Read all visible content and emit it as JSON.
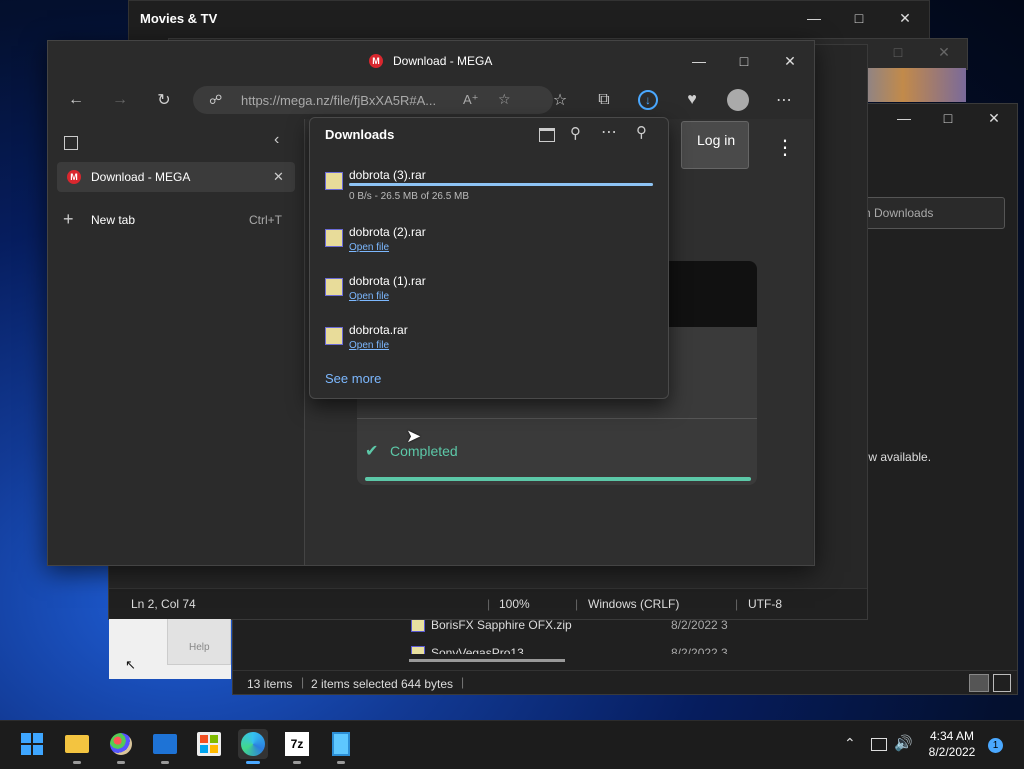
{
  "movies": {
    "title": "Movies & TV"
  },
  "explorer": {
    "search_placeholder": "ch Downloads",
    "preview_text": "iew available.",
    "files": [
      {
        "name": "BorisFX Sapphire OFX.zip",
        "date": "8/2/2022 3"
      },
      {
        "name": "SonyVegasPro13",
        "date": "8/2/2022 3"
      }
    ],
    "status": {
      "count": "13 items",
      "selected": "2 items selected",
      "size": "644 bytes"
    }
  },
  "notepad": {
    "status": {
      "position": "Ln 2, Col 74",
      "zoom": "100%",
      "eol": "Windows (CRLF)",
      "encoding": "UTF-8"
    },
    "help_label": "Help"
  },
  "edge": {
    "window_title": "Download - MEGA",
    "url": "https://mega.nz/file/fjBxXA5R#A...",
    "tabs": [
      {
        "label": "Download - MEGA"
      }
    ],
    "new_tab": {
      "label": "New tab",
      "shortcut": "Ctrl+T"
    },
    "page": {
      "login_label": "Log in",
      "completed_label": "Completed",
      "progress": 1.0
    }
  },
  "downloads": {
    "title": "Downloads",
    "items": [
      {
        "name": "dobrota (3).rar",
        "meta": "0 B/s - 26.5 MB of 26.5 MB",
        "progress": 1.0
      },
      {
        "name": "dobrota (2).rar",
        "link": "Open file"
      },
      {
        "name": "dobrota (1).rar",
        "link": "Open file"
      },
      {
        "name": "dobrota.rar",
        "link": "Open file"
      }
    ],
    "see_more": "See more"
  },
  "taskbar": {
    "apps": [
      "start-icon",
      "file-explorer-icon",
      "paint-icon",
      "movies-tv-icon",
      "store-icon",
      "edge-icon",
      "7zip-icon",
      "notepad-icon"
    ],
    "app_7zip_label": "7z",
    "clock": {
      "time": "4:34 AM",
      "date": "8/2/2022"
    },
    "notification_count": "1"
  },
  "colors": {
    "accent": "#4aa8ff",
    "mega_red": "#d9272e",
    "completed": "#5cc8a8",
    "link": "#7cb8ff"
  }
}
